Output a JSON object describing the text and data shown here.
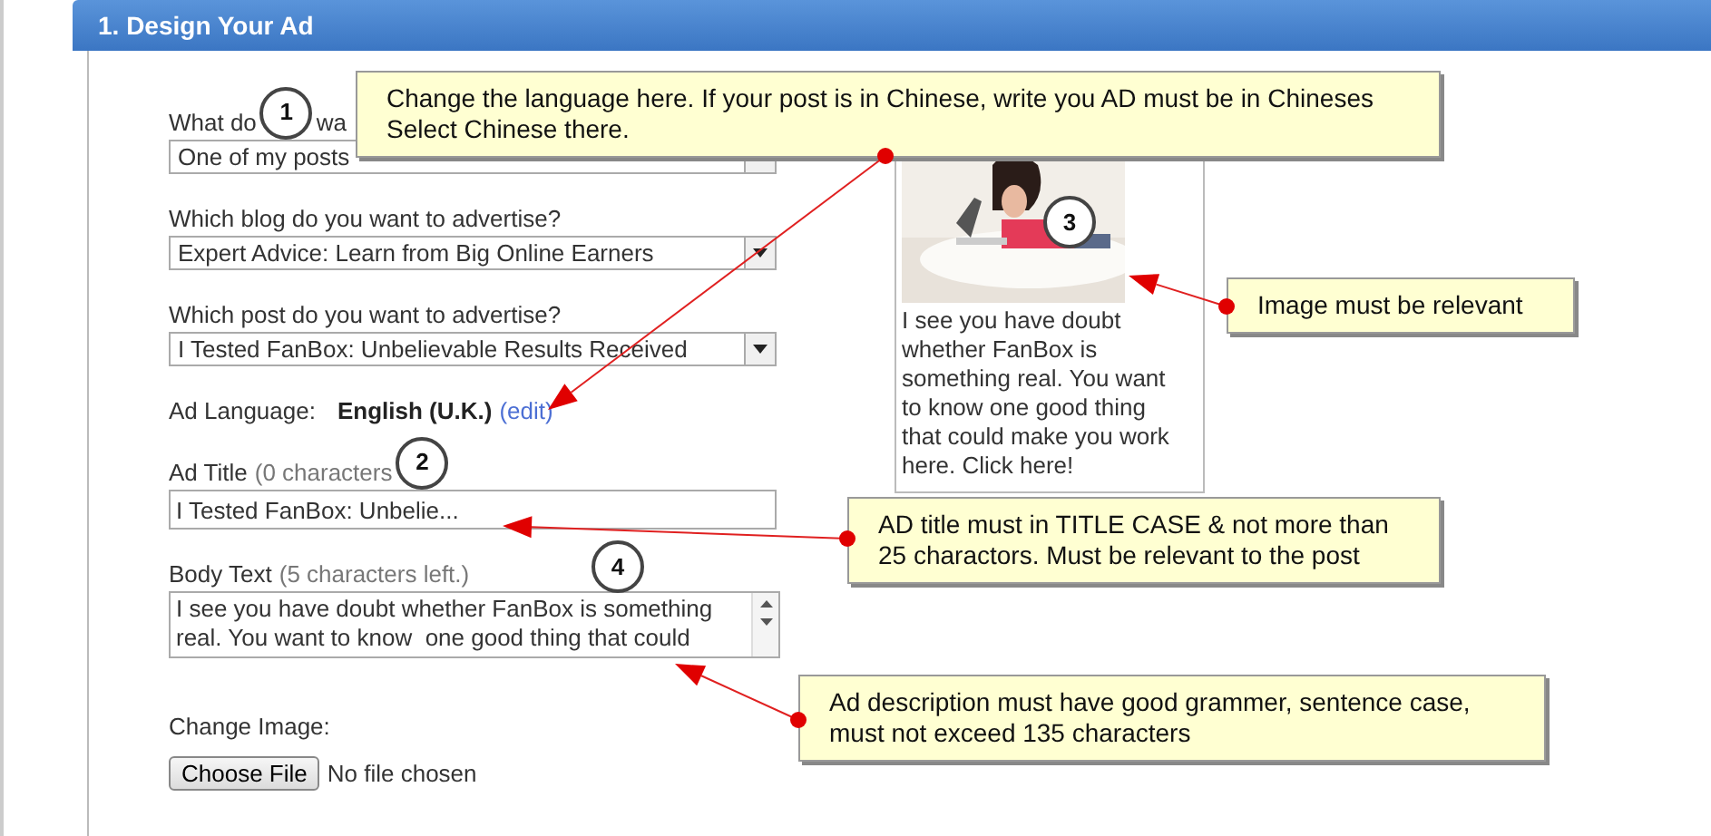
{
  "header": {
    "title": "1. Design Your Ad"
  },
  "fields": [
    {
      "kind": "select",
      "label": "What do",
      "label_tail": "wa",
      "marker": "1",
      "value": "One of my posts"
    },
    {
      "kind": "select",
      "label": "Which blog do you want to advertise?",
      "value": "Expert Advice: Learn from Big Online Earners"
    },
    {
      "kind": "select",
      "label": "Which post do you want to advertise?",
      "value": "I Tested FanBox: Unbelievable Results Received"
    },
    {
      "kind": "language",
      "label": "Ad Language:",
      "value": "English (U.K.)",
      "link": "(edit)"
    },
    {
      "kind": "text",
      "label": "Ad Title",
      "hint": "(0 characters",
      "marker": "2",
      "value": "I Tested FanBox: Unbelie..."
    },
    {
      "kind": "textarea",
      "label": "Body Text",
      "hint": "(5 characters left.)",
      "marker": "4",
      "value": "I see you have doubt whether FanBox is something real. You want to know  one good thing that could"
    },
    {
      "kind": "file",
      "label": "Change Image:",
      "button": "Choose File",
      "status": "No file chosen"
    }
  ],
  "preview": {
    "image": {
      "kind": "picture",
      "marker": "3"
    },
    "text": "I see you have doubt whether FanBox is something real. You want to know one good thing that could make you work here. Click here!"
  },
  "callouts": [
    {
      "lines": [
        "Change the language here. If your post is in Chinese, write you AD must be in Chineses",
        "Select Chinese there."
      ]
    },
    {
      "lines": [
        "Image must be relevant"
      ]
    },
    {
      "lines": [
        "AD title must in TITLE CASE & not more than",
        "25 charactors. Must be relevant to the post"
      ]
    },
    {
      "lines": [
        "Ad description must have good grammer, sentence case,",
        "must not exceed 135 characters"
      ]
    }
  ]
}
